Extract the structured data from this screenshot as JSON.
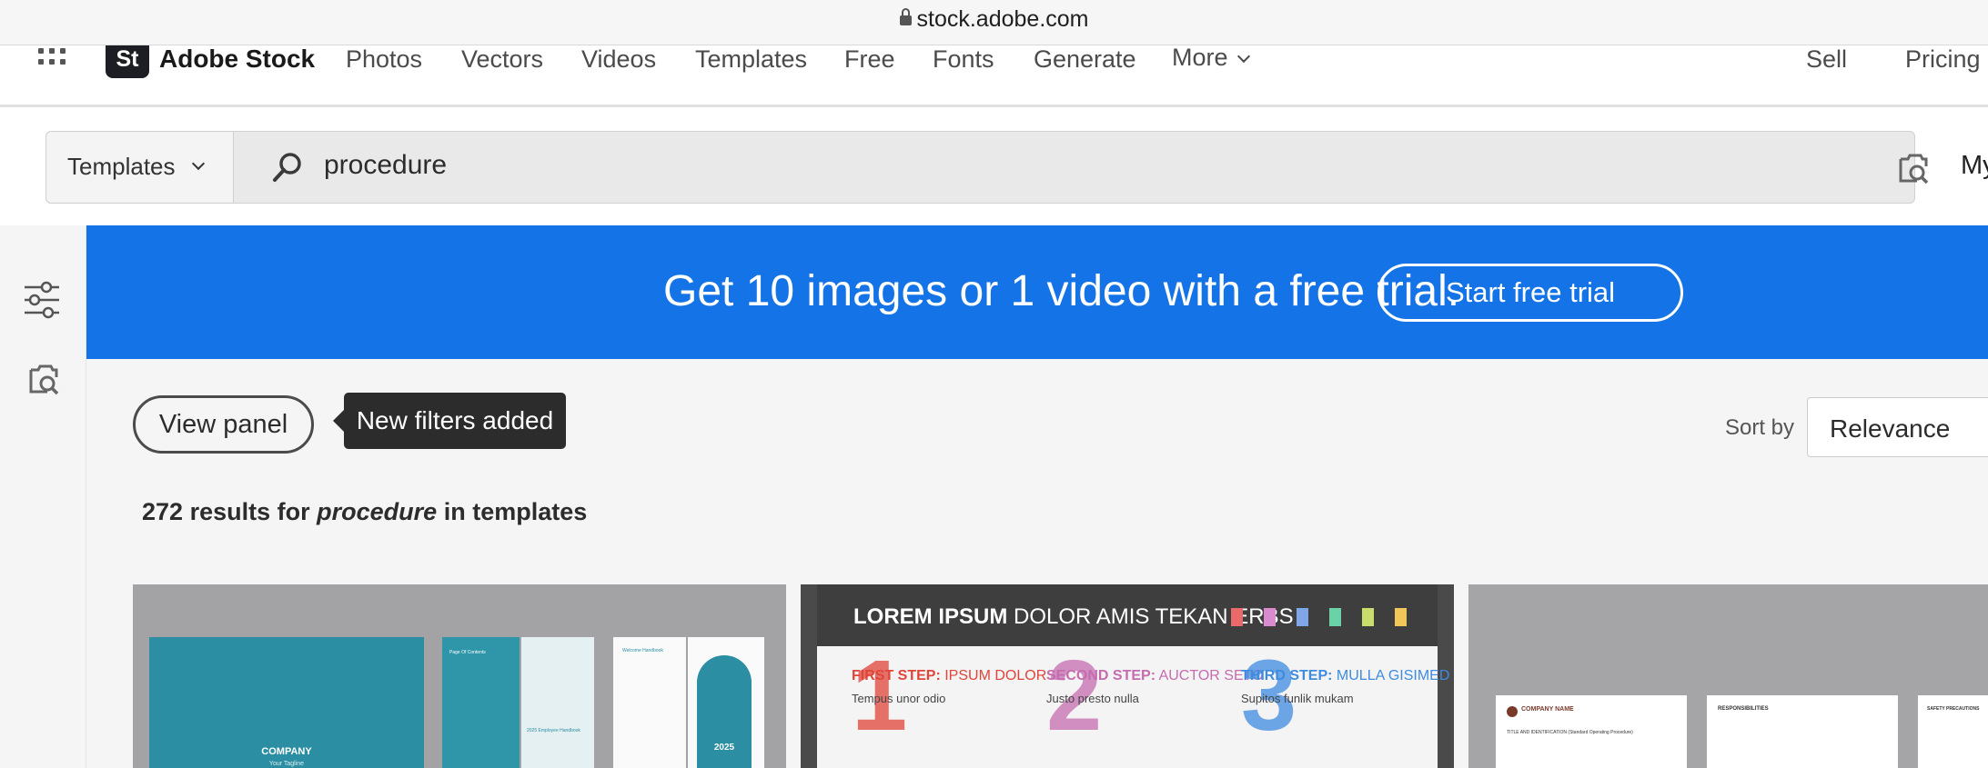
{
  "browser": {
    "url": "stock.adobe.com"
  },
  "nav": {
    "logo_badge": "St",
    "logo_text": "Adobe Stock",
    "items": [
      "Photos",
      "Vectors",
      "Videos",
      "Templates",
      "Free",
      "Fonts",
      "Generate"
    ],
    "more": "More",
    "right_items": [
      "Sell",
      "Pricing"
    ]
  },
  "search": {
    "type": "Templates",
    "query": "procedure",
    "account_cut": "My"
  },
  "banner": {
    "text": "Get 10 images or 1 video with a free trial.",
    "button": "Start free trial",
    "color": "#1473e6"
  },
  "controls": {
    "view_panel": "View panel",
    "tooltip": "New filters added",
    "sort_label": "Sort by",
    "sort_value": "Relevance"
  },
  "results": {
    "count": "272",
    "pre": "results for",
    "term": "procedure",
    "post": "in templates"
  },
  "tiles": {
    "t1": {
      "cover_company": "COMPANY",
      "cover_tagline": "Your Tagline",
      "spread_title": "Page Of Contents",
      "handbook": "2025 Employee Handbook",
      "welcome": "Welcome Handbook",
      "year": "2025"
    },
    "t2": {
      "header_bold": "LOREM IPSUM",
      "header_rest": "DOLOR AMIS TEKAN ERBS",
      "steps": [
        {
          "num": "1",
          "label": "FIRST STEP:",
          "sub": "IPSUM DOLOR",
          "body": "Tempus unor odio",
          "color": "#e0453a"
        },
        {
          "num": "2",
          "label": "SECOND STEP:",
          "sub": "AUCTOR SETO",
          "body": "Justo presto nulla",
          "color": "#c56cb0"
        },
        {
          "num": "3",
          "label": "THIRD STEP:",
          "sub": "MULLA GISIMED",
          "body": "Supitos funlik mukam",
          "color": "#3f8be0"
        }
      ],
      "swatches": [
        "#e86a6a",
        "#d98bd0",
        "#7fa6e6",
        "#6bd2a8",
        "#c9dc6e",
        "#f1c75a"
      ]
    },
    "t3": {
      "company": "COMPANY NAME",
      "title": "TITLE AND IDENTIFICATION (Standard Operating Procedure)",
      "responsibilities": "RESPONSIBILITIES",
      "safety": "SAFETY PRECAUTIONS"
    }
  }
}
